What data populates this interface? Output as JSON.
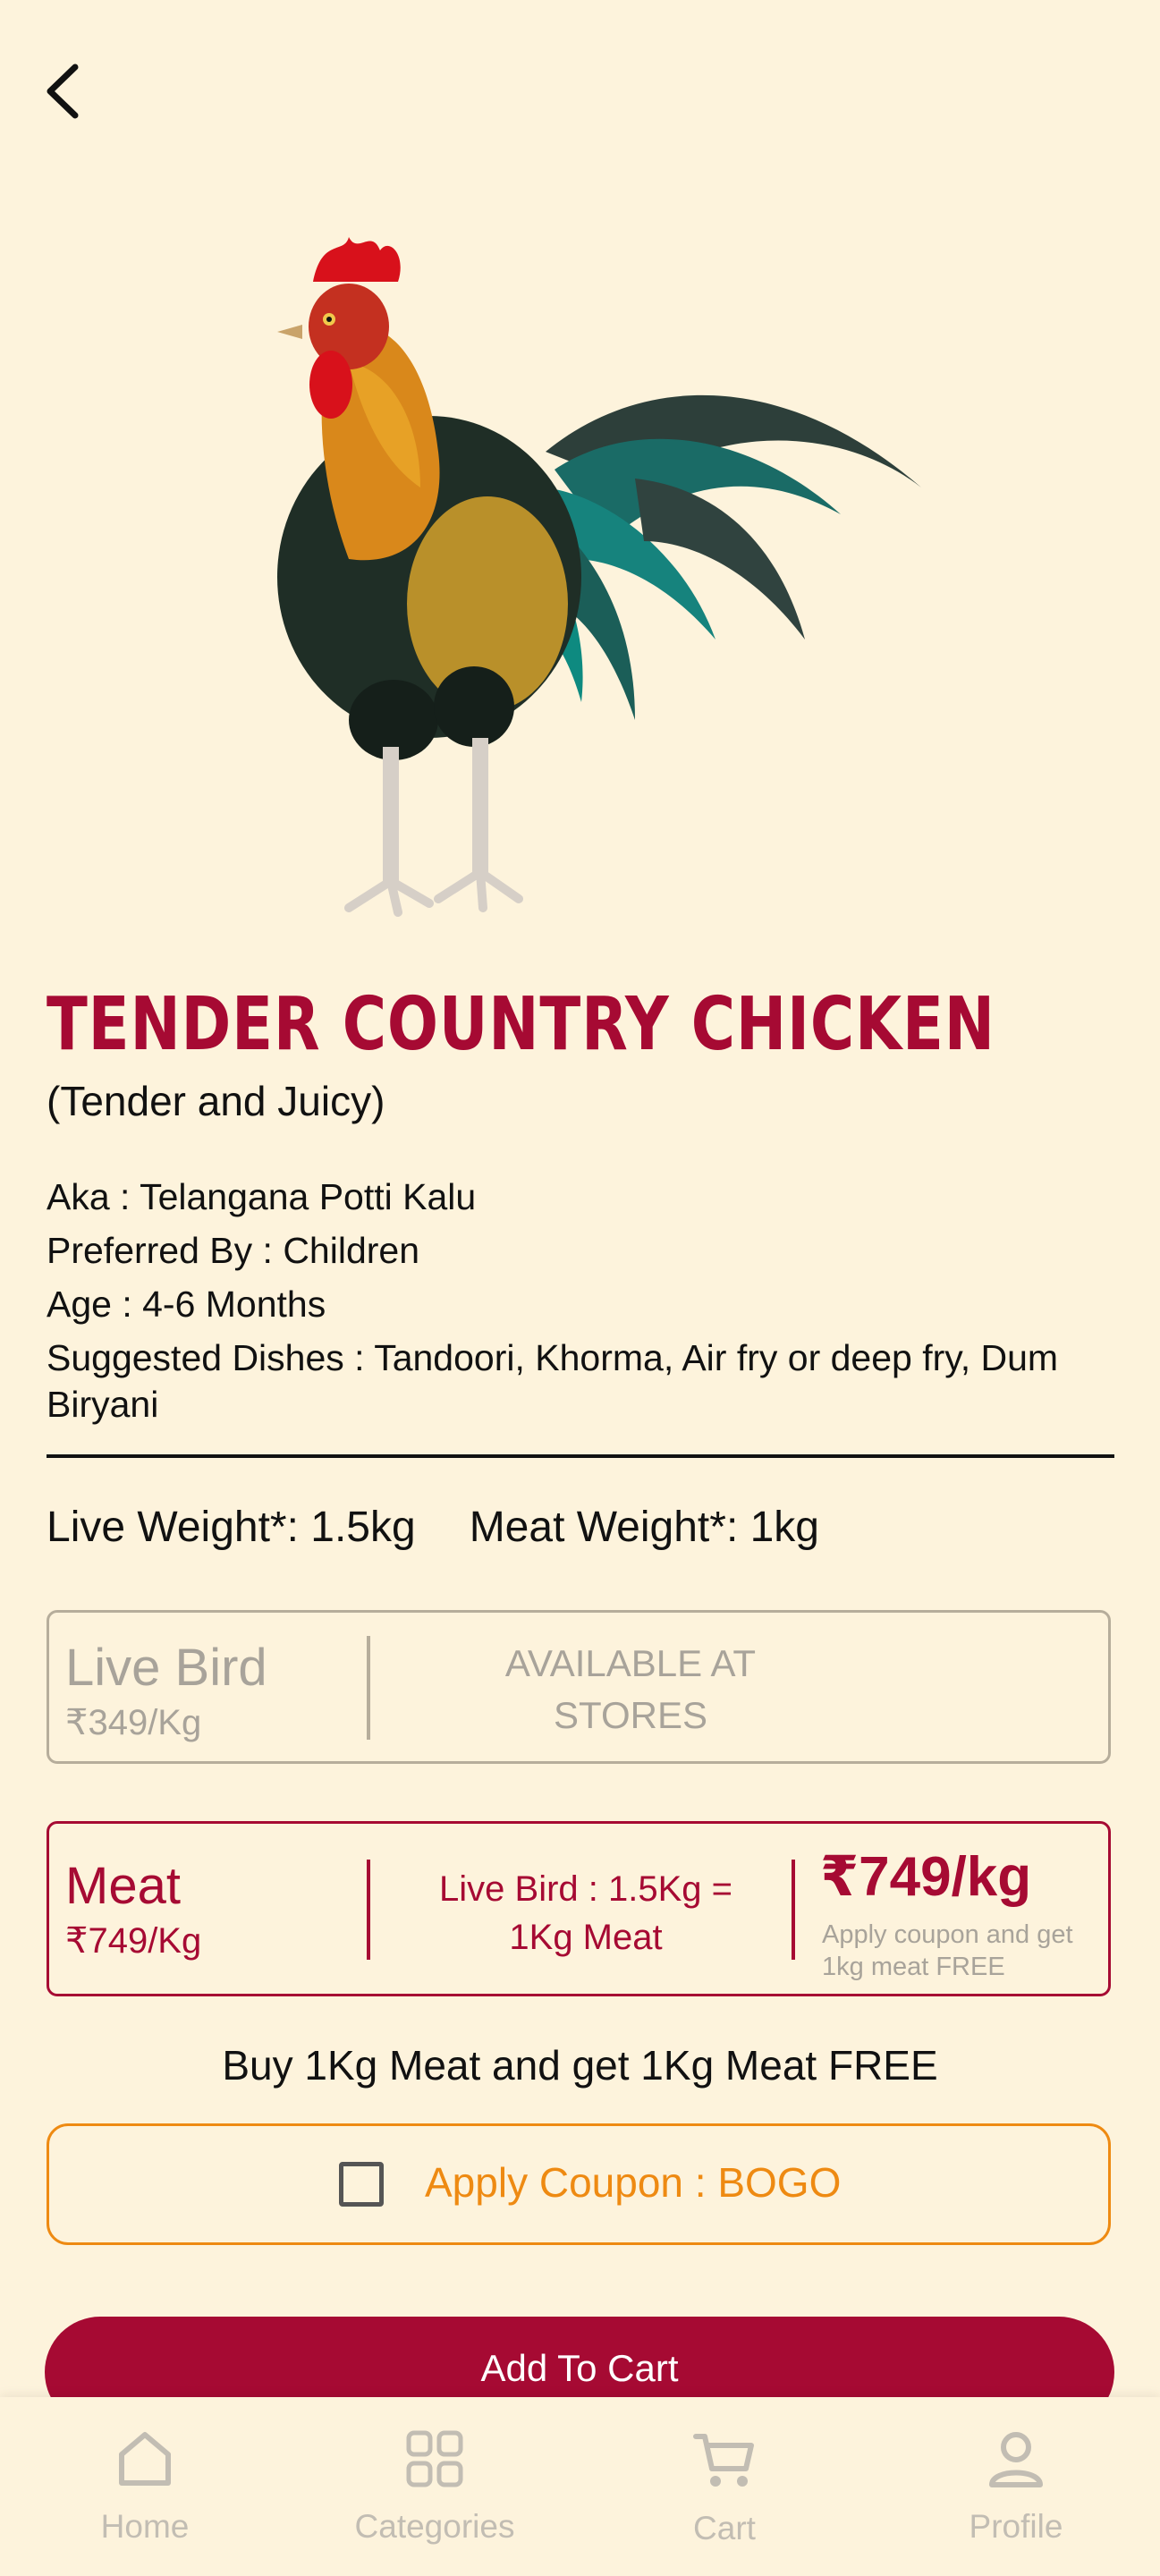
{
  "product": {
    "title": "TENDER COUNTRY CHICKEN",
    "subtitle": "(Tender and Juicy)",
    "aka": "Aka : Telangana Potti Kalu",
    "preferred_by": "Preferred By : Children",
    "age": "Age : 4-6 Months",
    "suggested_dishes_line1": "Suggested Dishes :  Tandoori, Khorma, Air fry or deep fry, Dum",
    "suggested_dishes_line2": "Biryani",
    "live_weight": "Live Weight*: 1.5kg",
    "meat_weight": "Meat Weight*: 1kg"
  },
  "options": {
    "live_bird": {
      "name": "Live Bird",
      "price": "₹349/Kg",
      "availability_line1": "AVAILABLE AT",
      "availability_line2": "STORES"
    },
    "meat": {
      "name": "Meat",
      "price": "₹749/Kg",
      "conversion_line1": "Live Bird : 1.5Kg =",
      "conversion_line2": "1Kg Meat",
      "big_price": "₹749/kg",
      "coupon_note": "Apply coupon and get 1kg meat FREE"
    }
  },
  "offer_text": "Buy 1Kg Meat and get 1Kg Meat FREE",
  "coupon": {
    "label": "Apply Coupon : BOGO",
    "checked": false
  },
  "add_to_cart_label": "Add To Cart",
  "bottom_nav": {
    "items": [
      {
        "label": "Home",
        "icon": "home-icon"
      },
      {
        "label": "Categories",
        "icon": "categories-icon"
      },
      {
        "label": "Cart",
        "icon": "cart-icon"
      },
      {
        "label": "Profile",
        "icon": "profile-icon"
      }
    ]
  },
  "colors": {
    "background": "#fdf3dc",
    "brand": "#a60a33",
    "coupon_accent": "#ee8a12",
    "muted": "#a8a39a"
  }
}
